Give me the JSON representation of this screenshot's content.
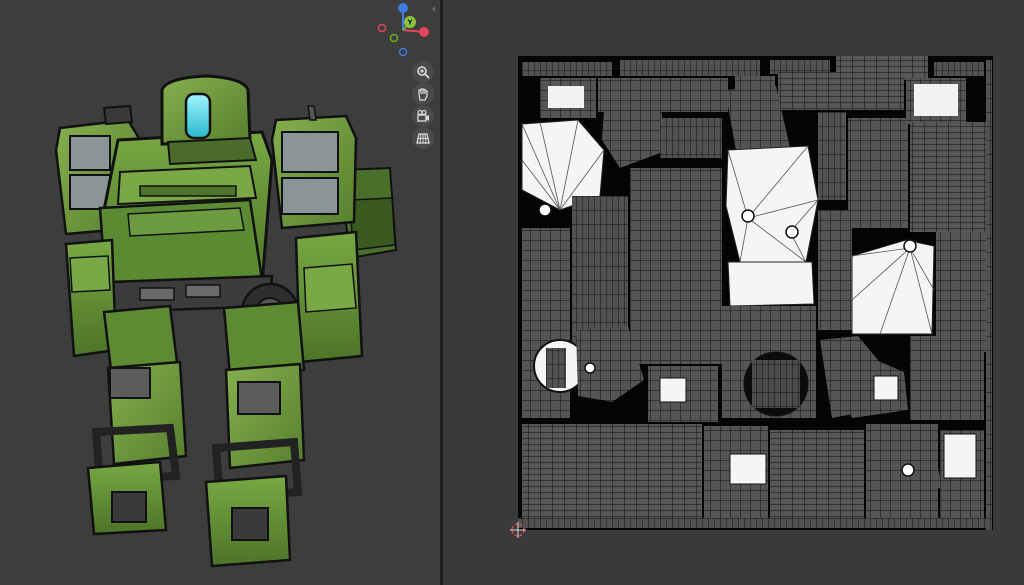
{
  "gizmo": {
    "axis_y_label": "Y",
    "colors": {
      "x_axis": "#e0465a",
      "y_axis": "#6dae2b",
      "z_axis": "#3c7be0",
      "y_ball": "#8cc33f"
    }
  },
  "navigation": {
    "icons": [
      "zoom-icon",
      "pan-hand-icon",
      "camera-view-icon",
      "perspective-grid-icon"
    ]
  },
  "colors": {
    "viewport_bg": "#3d3d3d",
    "uv_bg": "#3a3a3a",
    "robot_green": "#6c9a3c",
    "robot_dark": "#3c5f24",
    "cockpit_glow": "#36d1e0"
  }
}
